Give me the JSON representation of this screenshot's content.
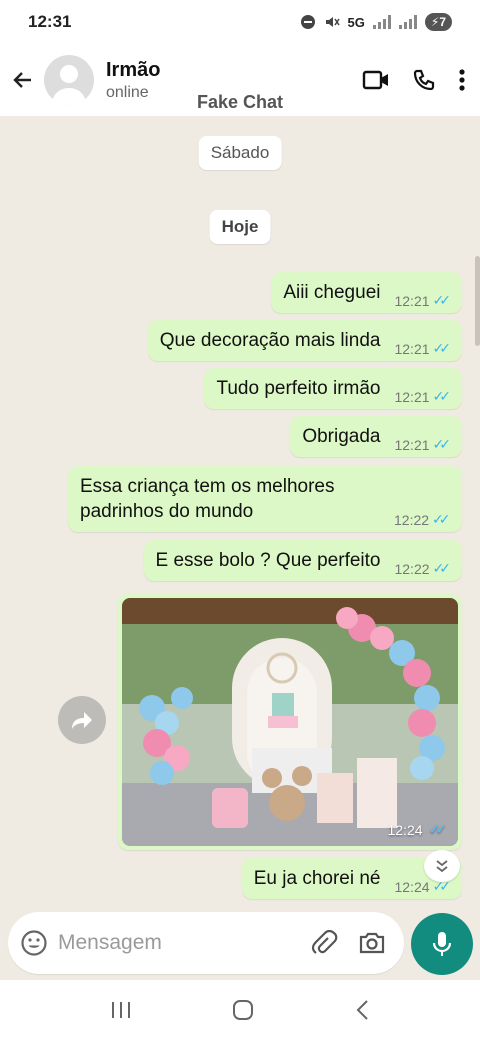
{
  "status_bar": {
    "time": "12:31",
    "network": "5G",
    "battery": "7"
  },
  "header": {
    "contact_name": "Irmão",
    "contact_status": "online",
    "watermark": "Fake Chat"
  },
  "dates": {
    "first": "Sábado",
    "second": "Hoje"
  },
  "messages": [
    {
      "text": "Aiii cheguei",
      "time": "12:21"
    },
    {
      "text": "Que decoração mais linda",
      "time": "12:21"
    },
    {
      "text": "Tudo perfeito irmão",
      "time": "12:21"
    },
    {
      "text": "Obrigada",
      "time": "12:21"
    },
    {
      "text": "Essa criança tem os melhores padrinhos do mundo",
      "time": "12:22"
    },
    {
      "text": "E esse bolo ? Que perfeito",
      "time": "12:22"
    },
    {
      "text": "Eu ja chorei né",
      "time": "12:24"
    }
  ],
  "image_message": {
    "time": "12:24",
    "description": "Decoração de festa com balões rosa e azul, bolo e ursinhos"
  },
  "input": {
    "placeholder": "Mensagem"
  },
  "colors": {
    "outgoing_bubble": "#dcf8c6",
    "chat_bg": "#efeae2",
    "accent": "#128c7e",
    "read_ticks": "#34b7f1"
  }
}
